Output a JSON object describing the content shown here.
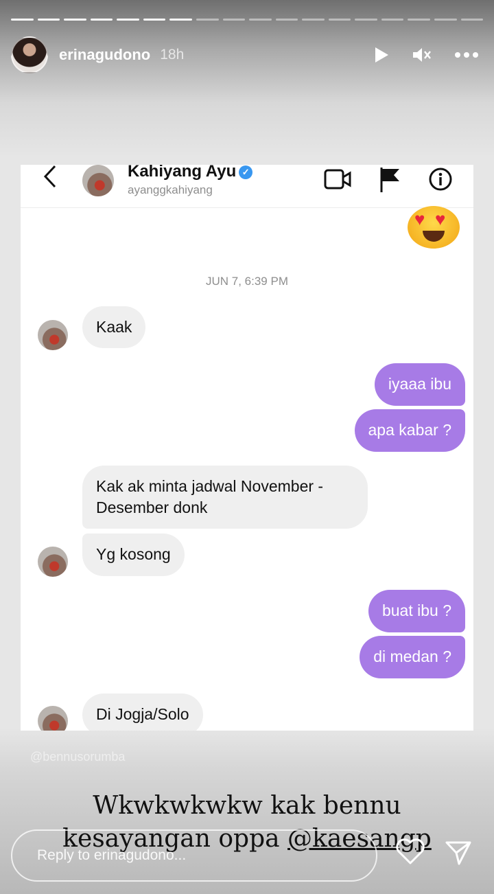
{
  "story": {
    "username": "erinagudono",
    "time": "18h",
    "segments_total": 18,
    "segments_viewed": 7
  },
  "dm": {
    "name": "Kahiyang Ayu",
    "handle": "ayanggkahiyang",
    "date_label": "JUN 7, 6:39 PM",
    "messages": [
      {
        "from": "them",
        "text": "Kaak"
      },
      {
        "from": "me",
        "text": "iyaaa ibu"
      },
      {
        "from": "me",
        "text": "apa kabar ?"
      },
      {
        "from": "them",
        "text": "Kak ak minta jadwal November - Desember donk"
      },
      {
        "from": "them",
        "text": "Yg kosong"
      },
      {
        "from": "me",
        "text": "buat ibu ?"
      },
      {
        "from": "me",
        "text": "di medan ?"
      },
      {
        "from": "them",
        "text": "Di Jogja/Solo"
      }
    ]
  },
  "watermark": "@bennusorumba",
  "caption": {
    "line1": "Wkwkwkwkw kak bennu",
    "line2_text": "kesayangan oppa ",
    "mention": "@kaesangp"
  },
  "reply": {
    "placeholder": "Reply to erinagudono..."
  },
  "colors": {
    "outgoing_bubble": "#a77be6",
    "incoming_bubble": "#efefef",
    "verified": "#3897f0"
  }
}
